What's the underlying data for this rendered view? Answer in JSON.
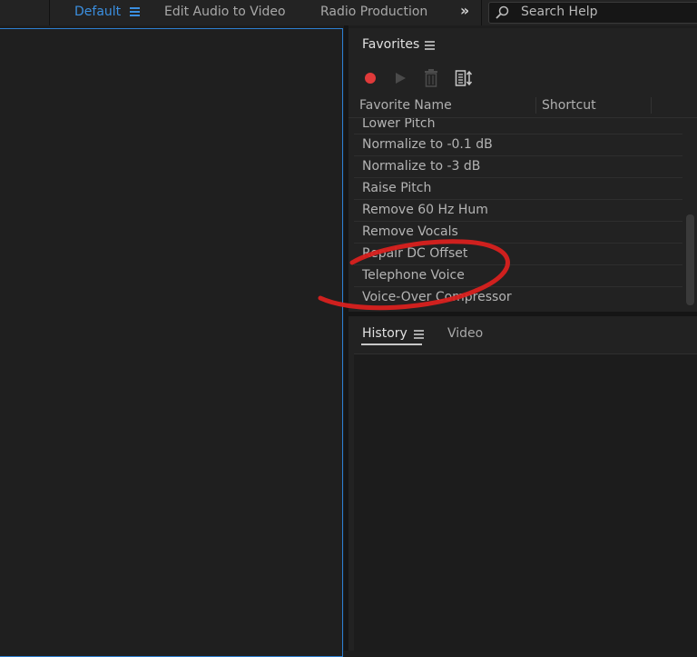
{
  "workspaces": {
    "tabs": [
      {
        "label": "Default",
        "active": true
      },
      {
        "label": "Edit Audio to Video",
        "active": false
      },
      {
        "label": "Radio Production",
        "active": false
      }
    ],
    "more_icon": "double-chevron-right-icon"
  },
  "search": {
    "label": "Search Help"
  },
  "favorites": {
    "title": "Favorites",
    "columns": {
      "name": "Favorite Name",
      "shortcut": "Shortcut"
    },
    "items": [
      "Lower Pitch",
      "Normalize to -0.1 dB",
      "Normalize to -3 dB",
      "Raise Pitch",
      "Remove 60 Hz Hum",
      "Remove Vocals",
      "Repair DC Offset",
      "Telephone Voice",
      "Voice-Over Compressor"
    ]
  },
  "history_panel": {
    "tabs": [
      {
        "label": "History",
        "active": true
      },
      {
        "label": "Video",
        "active": false
      }
    ]
  },
  "colors": {
    "accent": "#3b8fe0",
    "record": "#e03a3a",
    "annotation": "#d9211f",
    "background": "#1d1d1d"
  }
}
